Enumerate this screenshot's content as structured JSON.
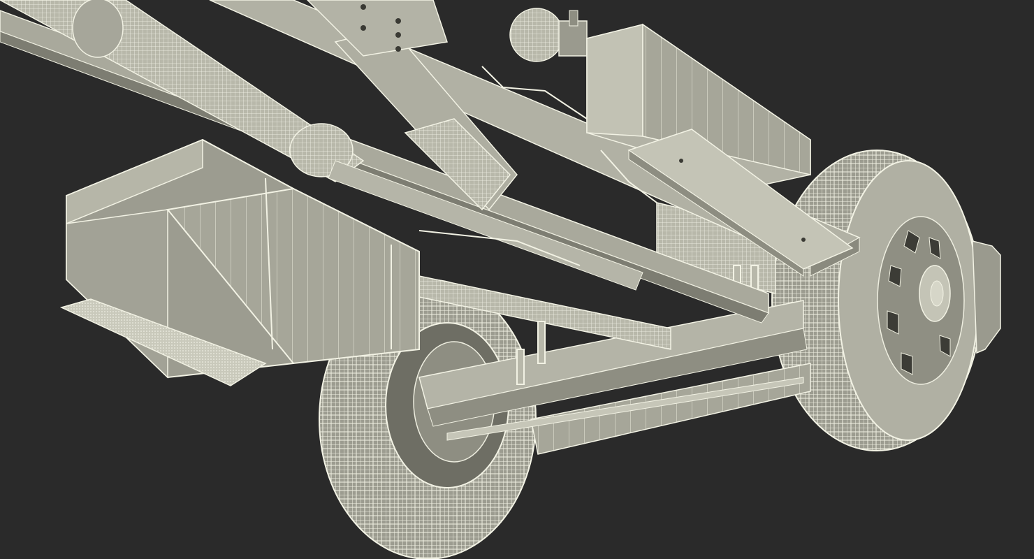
{
  "scene": {
    "subject": "truck-chassis-underside-wireframe",
    "colors": {
      "background": "#2a2a2a",
      "surface": "#a9a99c",
      "surface_dark": "#8b8b7f",
      "surface_light": "#c3c3b5",
      "tire": "#9a9a8e",
      "wire": "#f4f4e6",
      "shadow": "#5a5a52"
    }
  }
}
